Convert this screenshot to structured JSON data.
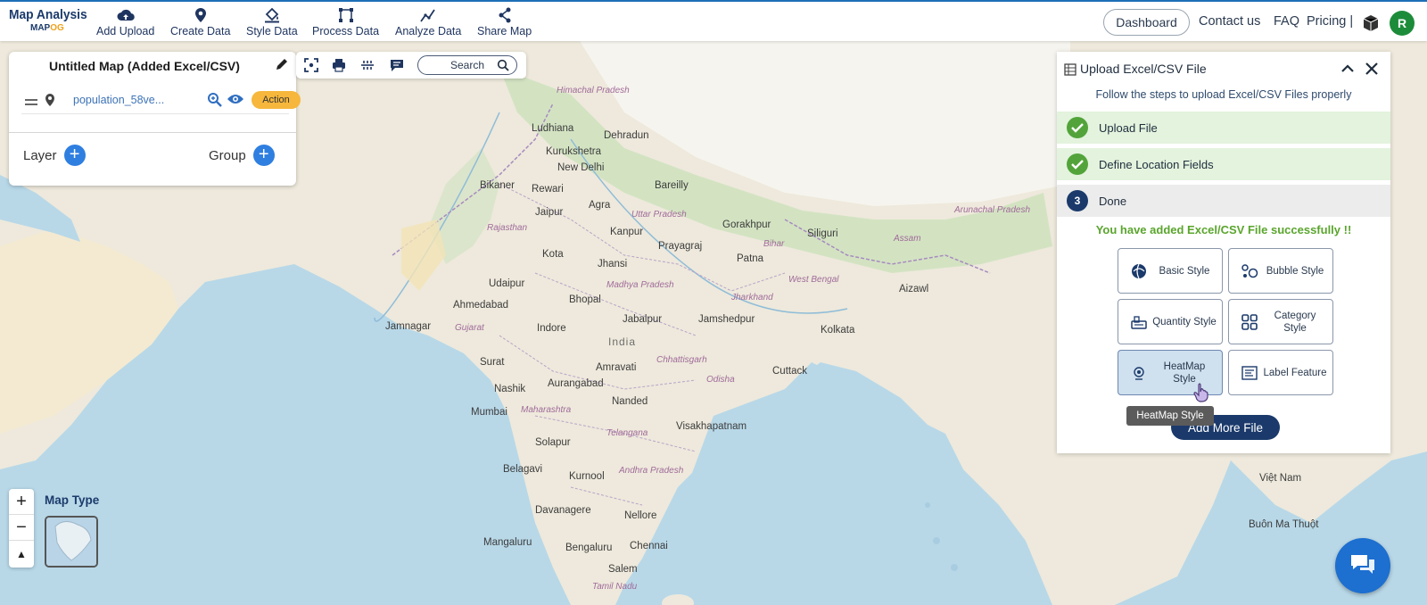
{
  "brand": {
    "title": "Map Analysis",
    "logo_prefix": "MAP",
    "logo_suffix": "OG"
  },
  "nav": [
    {
      "label": "Add Upload",
      "icon": "cloud-upload-icon"
    },
    {
      "label": "Create Data",
      "icon": "map-pin-icon"
    },
    {
      "label": "Style Data",
      "icon": "paint-bucket-icon"
    },
    {
      "label": "Process Data",
      "icon": "process-nodes-icon"
    },
    {
      "label": "Analyze Data",
      "icon": "analyze-chart-icon"
    },
    {
      "label": "Share Map",
      "icon": "share-icon"
    }
  ],
  "header_right": {
    "dashboard": "Dashboard",
    "contact": "Contact us",
    "faq": "FAQ",
    "pricing": "Pricing |",
    "avatar_letter": "R"
  },
  "layer_panel": {
    "map_title": "Untitled Map (Added Excel/CSV)",
    "layer_name": "population_58ve...",
    "action_label": "Action",
    "layer_label": "Layer",
    "group_label": "Group"
  },
  "map_tools": {
    "search_placeholder": "Search"
  },
  "upload_panel": {
    "title": "Upload Excel/CSV File",
    "subtitle": "Follow the steps to upload Excel/CSV Files properly",
    "steps": [
      {
        "label": "Upload File",
        "state": "done"
      },
      {
        "label": "Define Location Fields",
        "state": "done"
      },
      {
        "label": "Done",
        "number": "3",
        "state": "current"
      }
    ],
    "success_message": "You have added Excel/CSV File successfully !!",
    "style_buttons": [
      {
        "label": "Basic Style",
        "icon": "globe-icon"
      },
      {
        "label": "Bubble Style",
        "icon": "bubble-icon"
      },
      {
        "label": "Quantity Style",
        "icon": "quantity-icon"
      },
      {
        "label": "Category Style",
        "icon": "grid-icon"
      },
      {
        "label": "HeatMap Style",
        "icon": "heatmap-icon"
      },
      {
        "label": "Label Feature",
        "icon": "label-icon"
      }
    ],
    "tooltip": "HeatMap Style",
    "add_more": "Add More File"
  },
  "map_controls": {
    "zoom_in": "+",
    "zoom_out": "−",
    "reset": "▲",
    "map_type_label": "Map Type"
  },
  "map_labels": {
    "places": [
      "Ludhiana",
      "Dehradun",
      "Kurukshetra",
      "New Delhi",
      "Bikaner",
      "Rewari",
      "Bareilly",
      "Jaipur",
      "Agra",
      "Uttar Pradesh",
      "Gorakhpur",
      "Siliguri",
      "Rajasthan",
      "Kanpur",
      "Prayagraj",
      "Kota",
      "Jhansi",
      "Patna",
      "Bihar",
      "Assam",
      "Udaipur",
      "Madhya Pradesh",
      "Jharkhand",
      "West Bengal",
      "Aizawl",
      "Ahmedabad",
      "Bhopal",
      "Jabalpur",
      "Jamshedpur",
      "Jamnagar",
      "Gujarat",
      "Indore",
      "India",
      "Kolkata",
      "Surat",
      "Amravati",
      "Chhattisgarh",
      "Cuttack",
      "Nashik",
      "Aurangabad",
      "Odisha",
      "Mumbai",
      "Maharashtra",
      "Nanded",
      "Telangana",
      "Visakhapatnam",
      "Solapur",
      "Belagavi",
      "Kurnool",
      "Andhra Pradesh",
      "Davanagere",
      "Nellore",
      "Mangaluru",
      "Bengaluru",
      "Chennai",
      "Salem",
      "Tamil Nadu",
      "Himachal Pradesh",
      "Arunachal Pradesh",
      "Việt Nam",
      "Buôn Ma Thuột"
    ]
  }
}
